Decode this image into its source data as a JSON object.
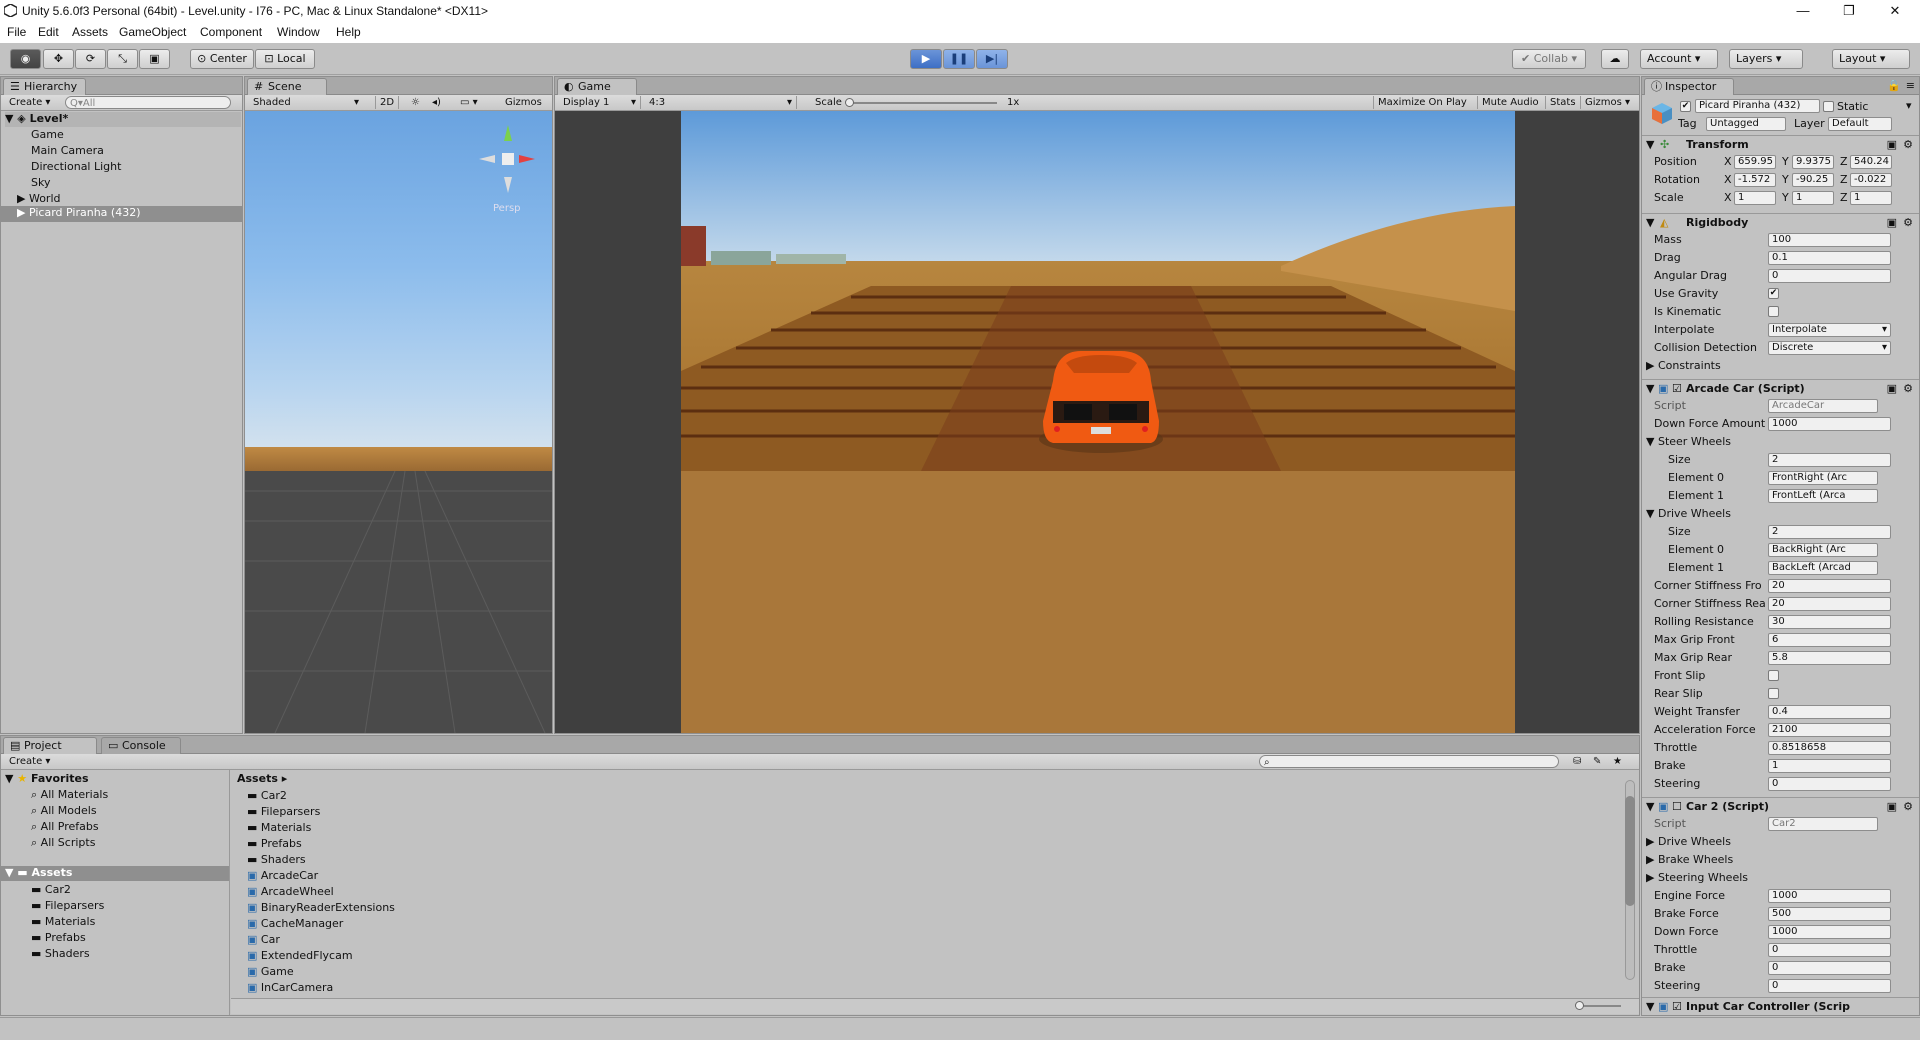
{
  "window": {
    "title": "Unity 5.6.0f3 Personal (64bit) - Level.unity - I76 - PC, Mac & Linux Standalone* <DX11>",
    "minimize": "—",
    "maximize": "❐",
    "close": "✕"
  },
  "menu": [
    "File",
    "Edit",
    "Assets",
    "GameObject",
    "Component",
    "Window",
    "Help"
  ],
  "toolbar": {
    "center": "Center",
    "local": "Local",
    "collab": "Collab",
    "account": "Account",
    "layers": "Layers",
    "layout": "Layout"
  },
  "hierarchy": {
    "tab": "Hierarchy",
    "create": "Create",
    "search_placeholder": "Q▾All",
    "scene": "Level*",
    "items": [
      "Game",
      "Main Camera",
      "Directional Light",
      "Sky",
      "World",
      "Picard Piranha (432)"
    ]
  },
  "scene": {
    "tab": "Scene",
    "shading": "Shaded",
    "mode2d": "2D",
    "gizmos": "Gizmos",
    "persp": "Persp"
  },
  "game": {
    "tab": "Game",
    "display": "Display 1",
    "aspect": "4:3",
    "scale_label": "Scale",
    "scale_value": "1x",
    "maximize": "Maximize On Play",
    "mute": "Mute Audio",
    "stats": "Stats",
    "gizmos": "Gizmos"
  },
  "project": {
    "tab": "Project",
    "console_tab": "Console",
    "create": "Create",
    "favorites_label": "Favorites",
    "favorites": [
      "All Materials",
      "All Models",
      "All Prefabs",
      "All Scripts"
    ],
    "assets_label": "Assets",
    "asset_tree": [
      "Car2",
      "Fileparsers",
      "Materials",
      "Prefabs",
      "Shaders"
    ],
    "breadcrumb": "Assets",
    "folders": [
      "Car2",
      "Fileparsers",
      "Materials",
      "Prefabs",
      "Shaders"
    ],
    "scripts": [
      "ArcadeCar",
      "ArcadeWheel",
      "BinaryReaderExtensions",
      "CacheManager",
      "Car",
      "ExtendedFlycam",
      "Game",
      "InCarCamera"
    ]
  },
  "inspector": {
    "tab": "Inspector",
    "object_name": "Picard Piranha (432)",
    "static": "Static",
    "tag_label": "Tag",
    "tag": "Untagged",
    "layer_label": "Layer",
    "layer": "Default",
    "transform": {
      "title": "Transform",
      "position_label": "Position",
      "position": [
        "659.95",
        "9.9375",
        "540.24"
      ],
      "rotation_label": "Rotation",
      "rotation": [
        "-1.572",
        "-90.25",
        "-0.022"
      ],
      "scale_label": "Scale",
      "scale": [
        "1",
        "1",
        "1"
      ]
    },
    "rigidbody": {
      "title": "Rigidbody",
      "fields": [
        {
          "label": "Mass",
          "value": "100"
        },
        {
          "label": "Drag",
          "value": "0.1"
        },
        {
          "label": "Angular Drag",
          "value": "0"
        }
      ],
      "use_gravity": "Use Gravity",
      "is_kinematic": "Is Kinematic",
      "interpolate_label": "Interpolate",
      "interpolate": "Interpolate",
      "collision_label": "Collision Detection",
      "collision": "Discrete",
      "constraints": "Constraints"
    },
    "arcade": {
      "title": "Arcade Car (Script)",
      "script_label": "Script",
      "script": "ArcadeCar",
      "down_force_label": "Down Force Amount",
      "down_force": "1000",
      "steer_label": "Steer Wheels",
      "steer_size_label": "Size",
      "steer_size": "2",
      "steer_e0_label": "Element 0",
      "steer_e0": "FrontRight (Arc",
      "steer_e1_label": "Element 1",
      "steer_e1": "FrontLeft (Arca",
      "drive_label": "Drive Wheels",
      "drive_size_label": "Size",
      "drive_size": "2",
      "drive_e0_label": "Element 0",
      "drive_e0": "BackRight (Arc",
      "drive_e1_label": "Element 1",
      "drive_e1": "BackLeft (Arcad",
      "fields": [
        {
          "label": "Corner Stiffness Fro",
          "value": "20"
        },
        {
          "label": "Corner Stiffness Rea",
          "value": "20"
        },
        {
          "label": "Rolling Resistance",
          "value": "30"
        },
        {
          "label": "Max Grip Front",
          "value": "6"
        },
        {
          "label": "Max Grip Rear",
          "value": "5.8"
        }
      ],
      "front_slip": "Front Slip",
      "rear_slip": "Rear Slip",
      "fields2": [
        {
          "label": "Weight Transfer",
          "value": "0.4"
        },
        {
          "label": "Acceleration Force",
          "value": "2100"
        },
        {
          "label": "Throttle",
          "value": "0.8518658"
        },
        {
          "label": "Brake",
          "value": "1"
        },
        {
          "label": "Steering",
          "value": "0"
        }
      ]
    },
    "car2": {
      "title": "Car 2 (Script)",
      "script_label": "Script",
      "script": "Car2",
      "drive": "Drive Wheels",
      "brake": "Brake Wheels",
      "steering": "Steering Wheels",
      "fields": [
        {
          "label": "Engine Force",
          "value": "1000"
        },
        {
          "label": "Brake Force",
          "value": "500"
        },
        {
          "label": "Down Force",
          "value": "1000"
        },
        {
          "label": "Throttle",
          "value": "0"
        },
        {
          "label": "Brake",
          "value": "0"
        },
        {
          "label": "Steering",
          "value": "0"
        }
      ]
    },
    "input": {
      "title": "Input Car Controller (Scrip"
    }
  }
}
